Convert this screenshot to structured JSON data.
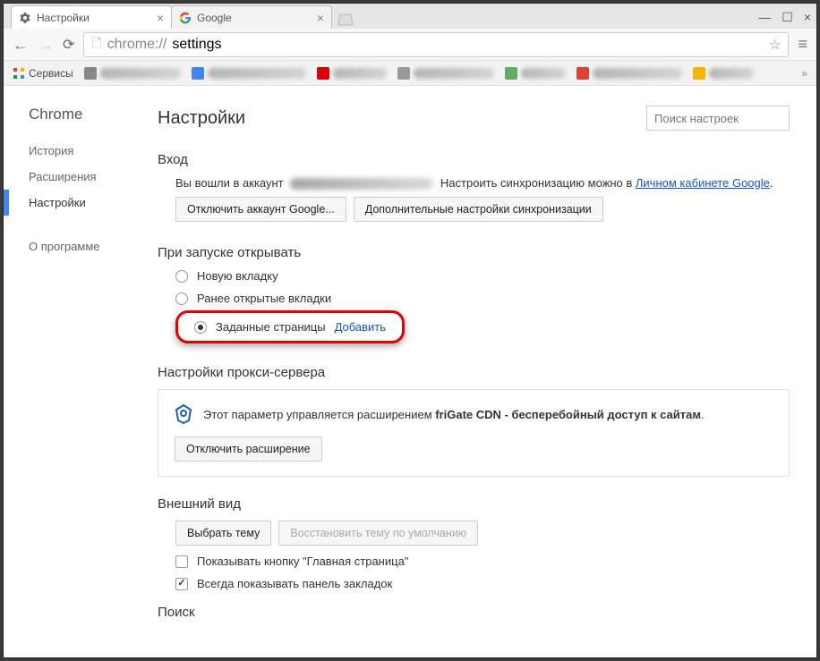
{
  "tabs": {
    "tab0_title": "Настройки",
    "tab1_title": "Google"
  },
  "omnibox": {
    "scheme": "chrome://",
    "path": "settings"
  },
  "bookmarksbar": {
    "services_label": "Сервисы"
  },
  "leftnav": {
    "brand": "Chrome",
    "history": "История",
    "extensions": "Расширения",
    "settings": "Настройки",
    "about": "О программе"
  },
  "header": {
    "title": "Настройки",
    "search_placeholder": "Поиск настроек"
  },
  "signin": {
    "section_title": "Вход",
    "prefix": "Вы вошли в аккаунт",
    "suffix": "Настроить синхронизацию можно в ",
    "account_link": "Личном кабинете Google",
    "disconnect_btn": "Отключить аккаунт Google...",
    "advanced_sync_btn": "Дополнительные настройки синхронизации"
  },
  "startup": {
    "section_title": "При запуске открывать",
    "radio_newtab": "Новую вкладку",
    "radio_continue": "Ранее открытые вкладки",
    "radio_specific": "Заданные страницы",
    "add_link": "Добавить"
  },
  "proxy": {
    "section_title": "Настройки прокси-сервера",
    "note_prefix": "Этот параметр управляется расширением ",
    "note_bold": "friGate CDN - бесперебойный доступ к сайтам",
    "note_suffix": ".",
    "disable_btn": "Отключить расширение"
  },
  "appearance": {
    "section_title": "Внешний вид",
    "theme_btn": "Выбрать тему",
    "reset_theme_btn": "Восстановить тему по умолчанию",
    "show_home": "Показывать кнопку \"Главная страница\"",
    "show_bookmarks": "Всегда показывать панель закладок"
  },
  "search": {
    "section_title": "Поиск"
  }
}
